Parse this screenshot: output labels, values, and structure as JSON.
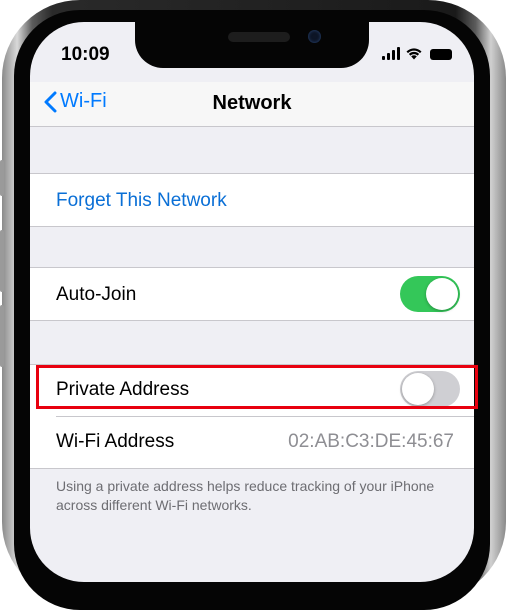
{
  "status_bar": {
    "time": "10:09"
  },
  "nav": {
    "back_label": "Wi-Fi",
    "title": "Network"
  },
  "actions": {
    "forget_label": "Forget This Network"
  },
  "settings": {
    "auto_join": {
      "label": "Auto-Join",
      "enabled": true
    },
    "private_address": {
      "label": "Private Address",
      "enabled": false
    },
    "wifi_address": {
      "label": "Wi-Fi Address",
      "value": "02:AB:C3:DE:45:67"
    }
  },
  "footer": {
    "note": "Using a private address helps reduce tracking of your iPhone across different Wi-Fi networks."
  },
  "colors": {
    "accent": "#007aff",
    "toggle_on": "#34c759",
    "toggle_off": "#cfcfd3",
    "highlight": "#e8000f"
  },
  "icons": {
    "back": "chevron-left-icon",
    "signal": "cellular-signal-icon",
    "wifi": "wifi-icon",
    "battery": "battery-icon"
  }
}
